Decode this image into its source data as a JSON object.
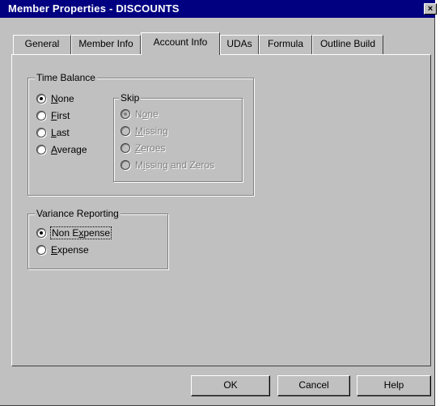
{
  "window": {
    "title": "Member Properties - DISCOUNTS",
    "close_glyph": "×"
  },
  "tabs": [
    {
      "label": "General",
      "active": false
    },
    {
      "label": "Member Info",
      "active": false
    },
    {
      "label": "Account Info",
      "active": true
    },
    {
      "label": "UDAs",
      "active": false
    },
    {
      "label": "Formula",
      "active": false
    },
    {
      "label": "Outline Build",
      "active": false
    }
  ],
  "time_balance": {
    "legend": "Time Balance",
    "options": [
      {
        "pre": "",
        "ul": "N",
        "post": "one",
        "checked": true
      },
      {
        "pre": "",
        "ul": "F",
        "post": "irst",
        "checked": false
      },
      {
        "pre": "",
        "ul": "L",
        "post": "ast",
        "checked": false
      },
      {
        "pre": "",
        "ul": "A",
        "post": "verage",
        "checked": false
      }
    ]
  },
  "skip": {
    "legend": "Skip",
    "options": [
      {
        "pre": "N",
        "ul": "o",
        "post": "ne",
        "checked": true
      },
      {
        "pre": "",
        "ul": "M",
        "post": "issing",
        "checked": false
      },
      {
        "pre": "",
        "ul": "Z",
        "post": "eroes",
        "checked": false
      },
      {
        "pre": "M",
        "ul": "i",
        "post": "ssing and Zeros",
        "checked": false
      }
    ]
  },
  "variance_reporting": {
    "legend": "Variance Reporting",
    "options": [
      {
        "pre": "Non E",
        "ul": "x",
        "post": "pense",
        "checked": true
      },
      {
        "pre": "",
        "ul": "E",
        "post": "xpense",
        "checked": false
      }
    ]
  },
  "buttons": {
    "ok": "OK",
    "cancel": "Cancel",
    "help": "Help"
  }
}
